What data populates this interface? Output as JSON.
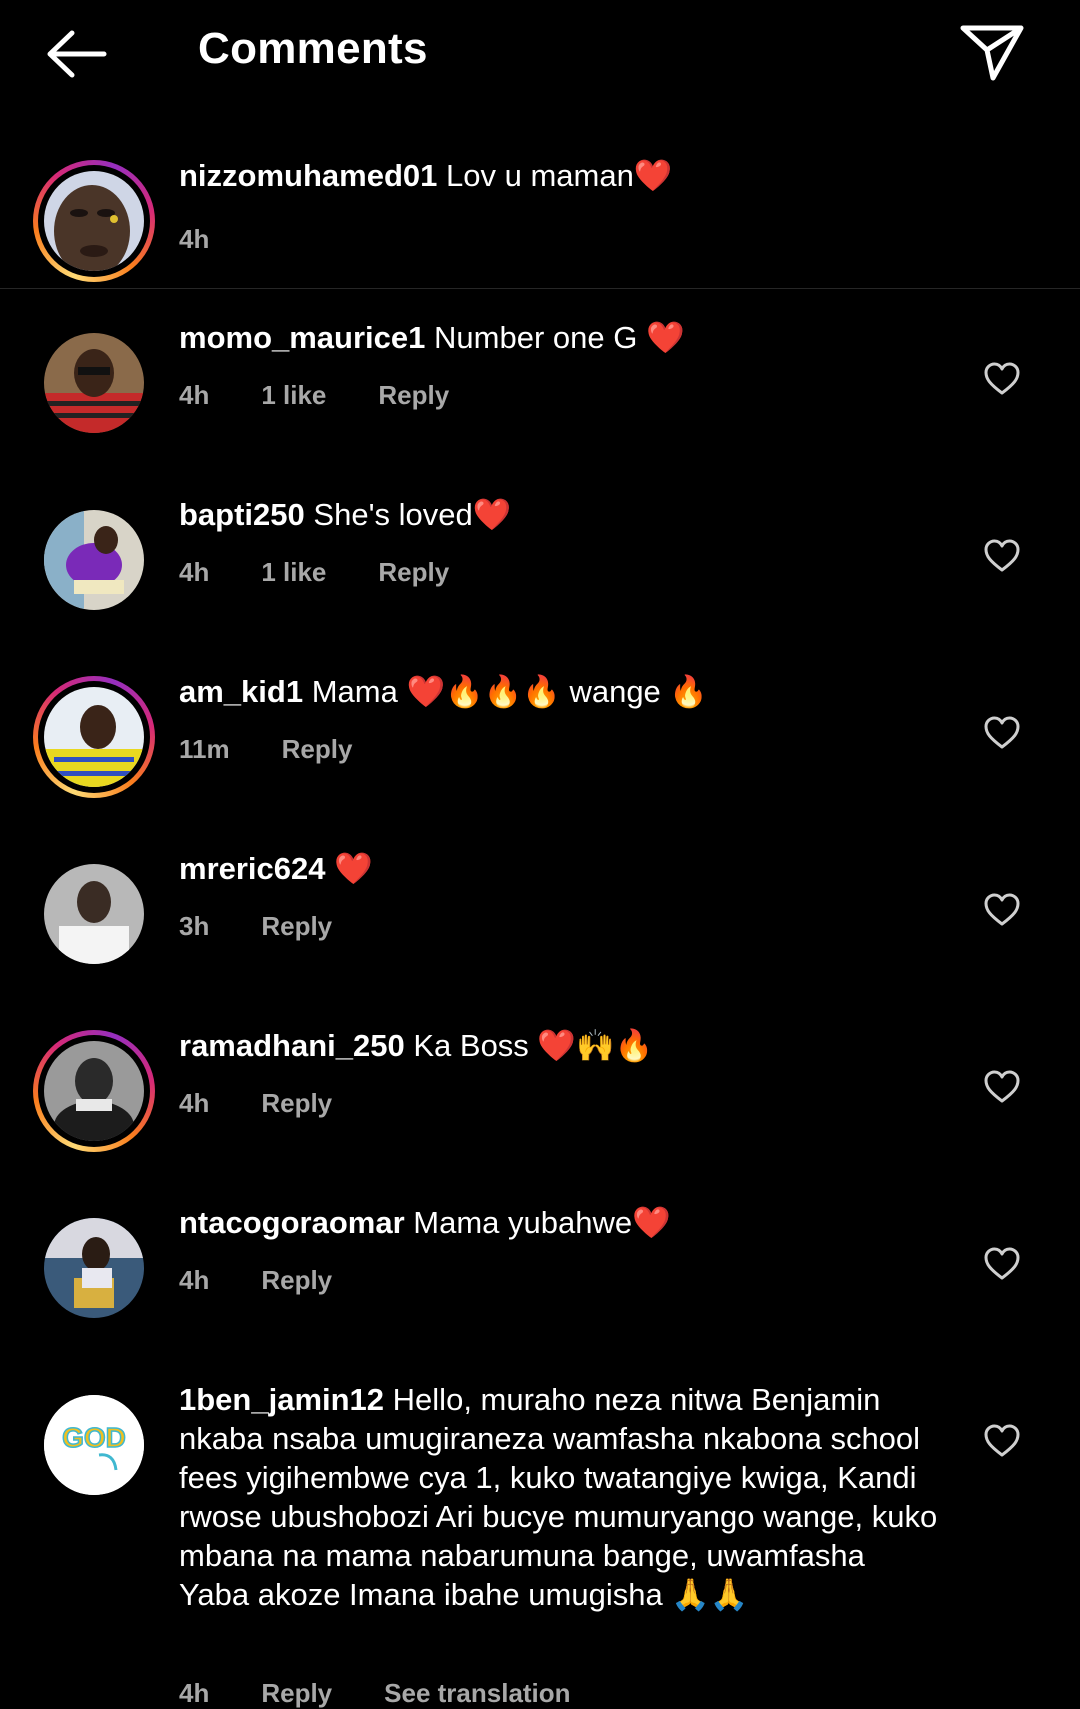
{
  "header": {
    "title": "Comments"
  },
  "caption": {
    "username": "nizzomuhamed01",
    "text": "Lov u maman❤️",
    "time": "4h"
  },
  "comments": [
    {
      "username": "momo_maurice1",
      "text": "Number one G ❤️",
      "time": "4h",
      "likes": "1 like",
      "reply": "Reply"
    },
    {
      "username": "bapti250",
      "text": "She's loved❤️",
      "time": "4h",
      "likes": "1 like",
      "reply": "Reply"
    },
    {
      "username": "am_kid1",
      "text": "Mama ❤️🔥🔥🔥 wange 🔥",
      "time": "11m",
      "reply": "Reply"
    },
    {
      "username": "mreric624",
      "text": "❤️",
      "time": "3h",
      "reply": "Reply"
    },
    {
      "username": "ramadhani_250",
      "text": "Ka Boss ❤️🙌🔥",
      "time": "4h",
      "reply": "Reply"
    },
    {
      "username": "ntacogoraomar",
      "text": "Mama yubahwe❤️",
      "time": "4h",
      "reply": "Reply"
    },
    {
      "username": "1ben_jamin12",
      "text": "Hello, muraho neza nitwa Benjamin nkaba nsaba umugiraneza wamfasha nkabona school fees yigihembwe cya 1, kuko twatangiye kwiga, Kandi rwose ubushobozi Ari bucye mumuryango wange, kuko mbana na mama nabarumuna bange, uwamfasha Yaba akoze Imana ibahe umugisha 🙏🙏",
      "time": "4h",
      "reply": "Reply",
      "translate": "See translation",
      "avatar_text": "GOD"
    }
  ],
  "colors": {
    "background": "#000000",
    "secondary_text": "#a8a8a8",
    "story_ring": [
      "#feda75",
      "#fa7e1e",
      "#d62976",
      "#962fbf"
    ]
  },
  "icons": {
    "back": "arrow-left-icon",
    "share": "paper-plane-icon",
    "like": "heart-outline-icon"
  }
}
